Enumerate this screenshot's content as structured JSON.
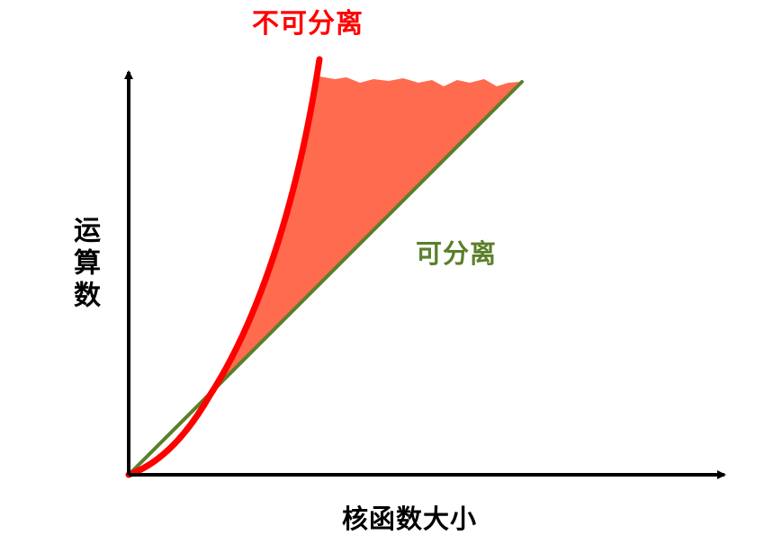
{
  "labels": {
    "non_separable": "不可分离",
    "separable": "可分离",
    "y_axis": "运算数",
    "x_axis": "核函数大小"
  },
  "colors": {
    "non_separable": "#ff0000",
    "separable": "#5b7f2a",
    "gap_fill": "#ff6b4f",
    "axis": "#000000"
  }
}
